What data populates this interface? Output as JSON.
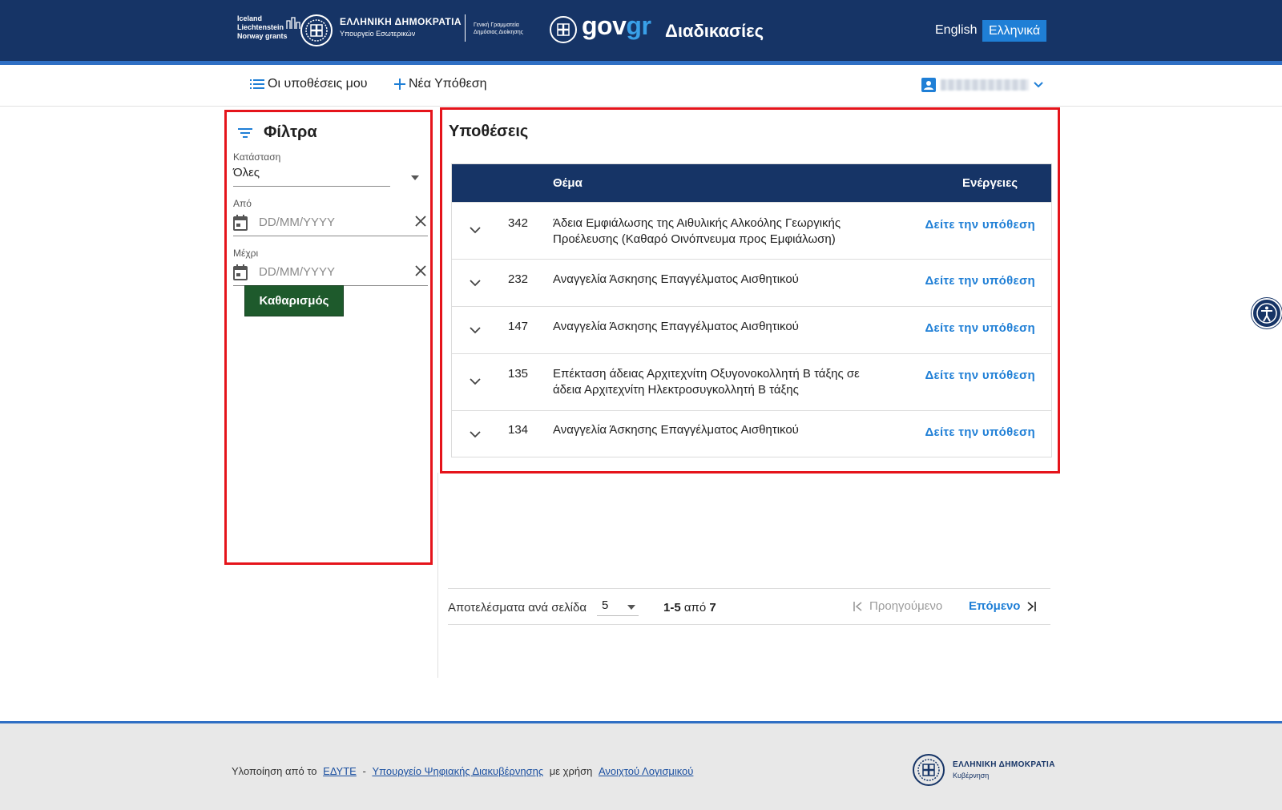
{
  "header": {
    "grants_lines": [
      "Iceland",
      "Liechtenstein",
      "Norway grants"
    ],
    "hd_title": "ΕΛΛΗΝΙΚΗ ΔΗΜΟΚΡΑΤΙΑ",
    "hd_sub": "Υπουργείο Εσωτερικών",
    "gg_line1": "Γενική Γραμματεία",
    "gg_line2": "Δημόσιας Διοίκησης",
    "govgr_gov": "gov",
    "govgr_gr": "gr",
    "procedures": "Διαδικασίες",
    "lang_en": "English",
    "lang_el": "Ελληνικά"
  },
  "nav": {
    "my_cases": "Οι υποθέσεις μου",
    "new_case": "Νέα Υπόθεση"
  },
  "filters": {
    "title": "Φίλτρα",
    "status_label": "Κατάσταση",
    "status_value": "Όλες",
    "from_label": "Από",
    "from_placeholder": "DD/MM/YYYY",
    "to_label": "Μέχρι",
    "to_placeholder": "DD/MM/YYYY",
    "clear_button": "Καθαρισμός"
  },
  "cases": {
    "title": "Υποθέσεις",
    "col_subject": "Θέμα",
    "col_actions": "Ενέργειες",
    "rows": [
      {
        "id": "342",
        "subject": "Άδεια Εμφιάλωσης της Αιθυλικής Αλκοόλης Γεωργικής Προέλευσης (Καθαρό Οινόπνευμα προς Εμφιάλωση)",
        "action": "Δείτε την υπόθεση"
      },
      {
        "id": "232",
        "subject": "Αναγγελία Άσκησης Επαγγέλματος Αισθητικού",
        "action": "Δείτε την υπόθεση"
      },
      {
        "id": "147",
        "subject": "Αναγγελία Άσκησης Επαγγέλματος Αισθητικού",
        "action": "Δείτε την υπόθεση"
      },
      {
        "id": "135",
        "subject": "Επέκταση άδειας Αρχιτεχνίτη Οξυγονοκολλητή Β τάξης σε άδεια Αρχιτεχνίτη Ηλεκτροσυγκολλητή Β τάξης",
        "action": "Δείτε την υπόθεση"
      },
      {
        "id": "134",
        "subject": "Αναγγελία Άσκησης Επαγγέλματος Αισθητικού",
        "action": "Δείτε την υπόθεση"
      }
    ]
  },
  "pagination": {
    "per_page_label": "Αποτελέσματα ανά σελίδα",
    "per_page_value": "5",
    "range": "1-5",
    "of": "από",
    "total": "7",
    "prev": "Προηγούμενο",
    "next": "Επόμενο"
  },
  "footer": {
    "prefix": "Υλοποίηση από το",
    "link1": "ΕΔΥΤΕ",
    "dash": "-",
    "link2": "Υπουργείο Ψηφιακής Διακυβέρνησης",
    "middle": "με χρήση",
    "link3": "Ανοιχτού Λογισμικού",
    "hd_title": "ΕΛΛΗΝΙΚΗ ΔΗΜΟΚΡΑΤΙΑ",
    "hd_sub": "Κυβέρνηση"
  },
  "colors": {
    "navy": "#163466",
    "accent_blue": "#1f7fd6",
    "stripe_blue": "#2f6fc4",
    "green_button": "#1e5a2c",
    "highlight_red": "#e5141b"
  },
  "icons": [
    "list-icon",
    "plus-icon",
    "user-icon",
    "chevron-down-icon",
    "filter-icon",
    "calendar-icon",
    "close-icon",
    "first-page-icon",
    "last-page-icon",
    "accessibility-icon"
  ]
}
